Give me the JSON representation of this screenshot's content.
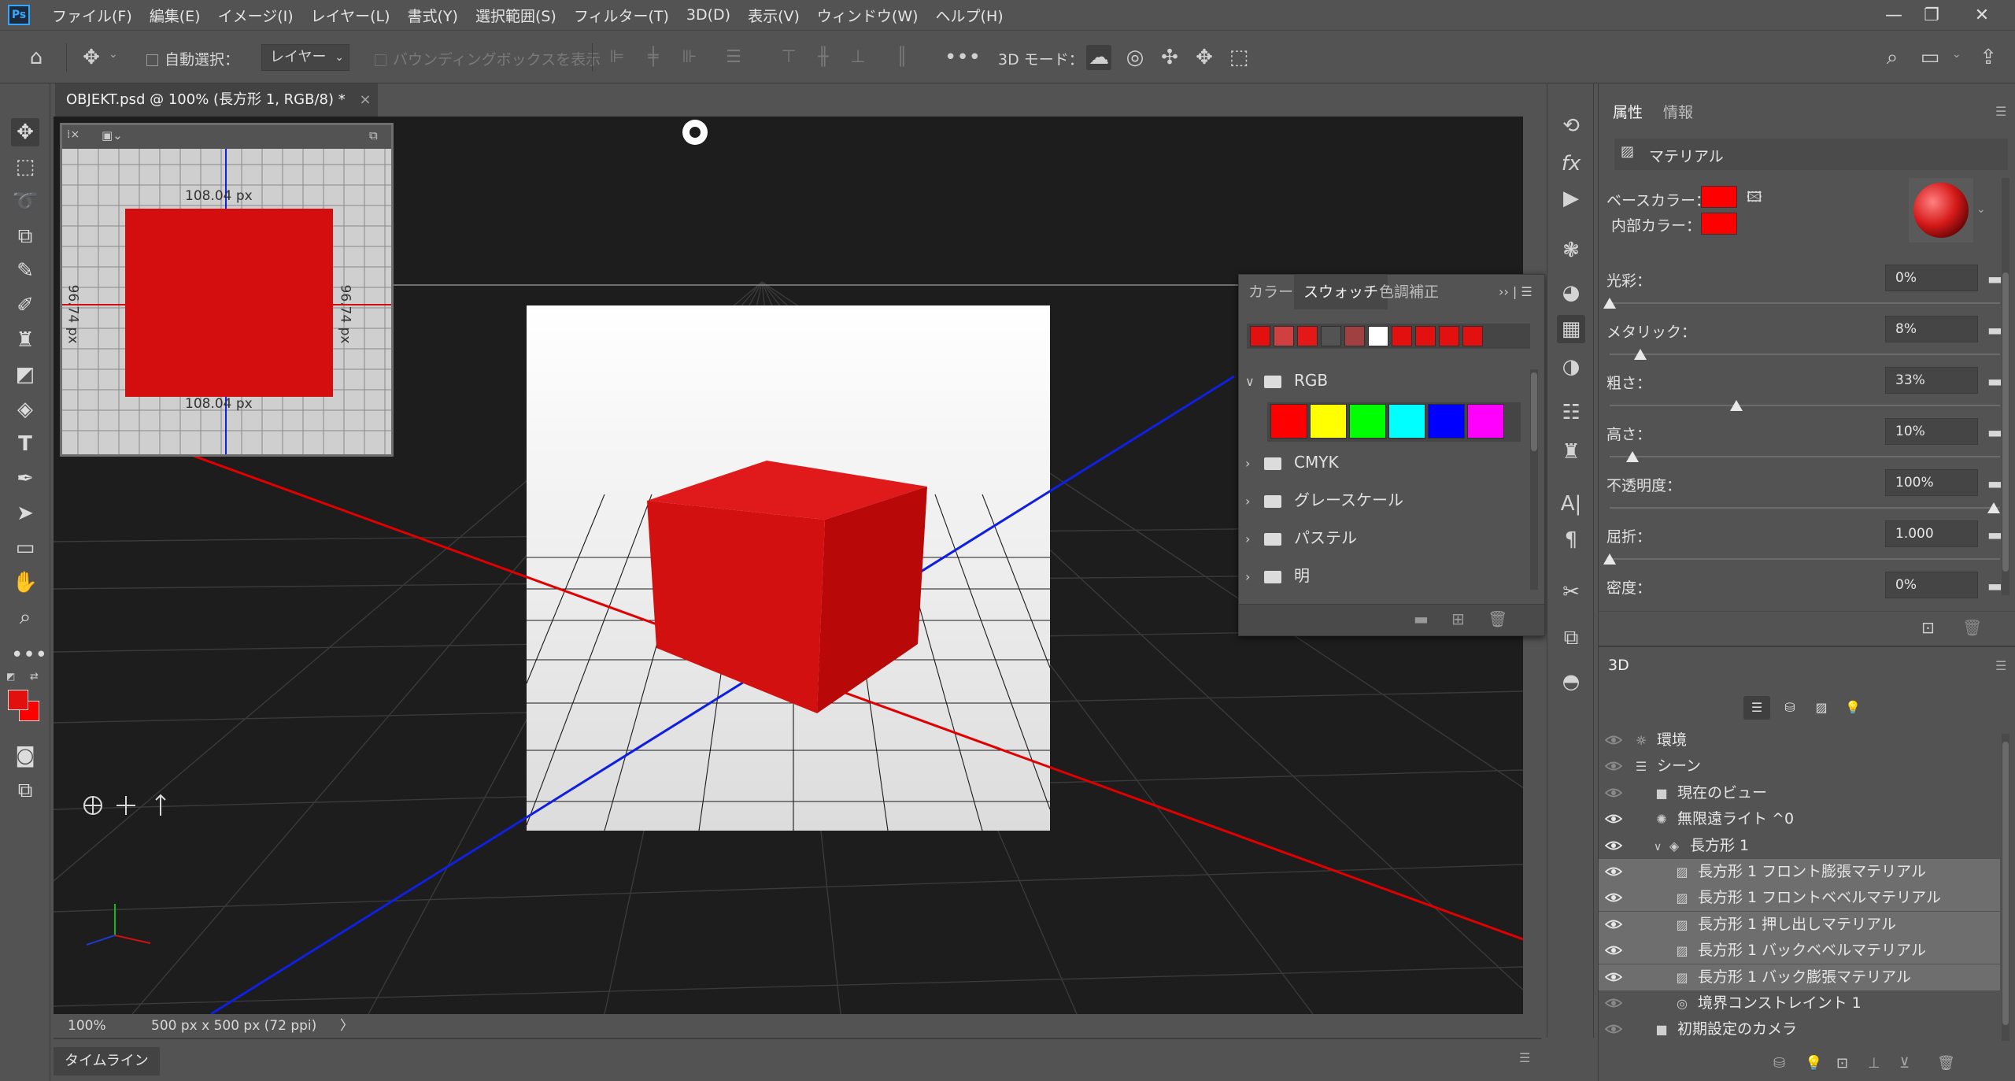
{
  "app": {
    "logo": "Ps"
  },
  "menu": [
    "ファイル(F)",
    "編集(E)",
    "イメージ(I)",
    "レイヤー(L)",
    "書式(Y)",
    "選択範囲(S)",
    "フィルター(T)",
    "3D(D)",
    "表示(V)",
    "ウィンドウ(W)",
    "ヘルプ(H)"
  ],
  "window_controls": {
    "minimize": "—",
    "restore": "❐",
    "close": "✕"
  },
  "options": {
    "auto_select_label": "自動選択：",
    "auto_select_target": "レイヤー",
    "bounding_box_label": "バウンディングボックスを表示",
    "three_d_mode_label": "3D モード："
  },
  "document": {
    "tab_title": "OBJEKT.psd @ 100% (長方形 1, RGB/8) *",
    "close_glyph": "×",
    "zoom": "100%",
    "doc_info": "500 px x 500 px (72 ppi)",
    "status_arrow": "〉"
  },
  "secondary_view": {
    "dim_top": "108.04  px",
    "dim_bottom": "108.04  px",
    "dim_left": "96.74  px",
    "dim_right": "96.74  px"
  },
  "swatches": {
    "tabs": [
      "カラー",
      "スウォッチ",
      "色調補正"
    ],
    "active_tab": 1,
    "recent_colors": [
      "#e31010",
      "#d04040",
      "#e51818",
      "#535353",
      "#a04040",
      "#ffffff",
      "#e31010",
      "#e31010",
      "#e31010",
      "#e31010"
    ],
    "groups": [
      {
        "name": "RGB",
        "expanded": true,
        "colors": [
          "#ff0000",
          "#ffff00",
          "#00ff00",
          "#00ffff",
          "#0000ff",
          "#ff00ff"
        ]
      },
      {
        "name": "CMYK",
        "expanded": false
      },
      {
        "name": "グレースケール",
        "expanded": false
      },
      {
        "name": "パステル",
        "expanded": false
      },
      {
        "name": "明",
        "expanded": false
      }
    ]
  },
  "properties": {
    "tabs": [
      "属性",
      "情報"
    ],
    "section": "マテリアル",
    "base_color_label": "ベースカラー：",
    "inner_color_label": "内部カラー：",
    "base_color": "#ff0000",
    "inner_color": "#ff0000",
    "params": [
      {
        "label": "光彩：",
        "value": "0%",
        "fraction": 0.0
      },
      {
        "label": "メタリック：",
        "value": "8%",
        "fraction": 0.08
      },
      {
        "label": "粗さ：",
        "value": "33%",
        "fraction": 0.33
      },
      {
        "label": "高さ：",
        "value": "10%",
        "fraction": 0.06
      },
      {
        "label": "不透明度：",
        "value": "100%",
        "fraction": 1.0
      },
      {
        "label": "屈折：",
        "value": "1.000",
        "fraction": 0.0
      },
      {
        "label": "密度：",
        "value": "0%",
        "fraction": null
      }
    ]
  },
  "panel3d": {
    "title": "3D",
    "items": [
      {
        "label": "環境",
        "indent": 0,
        "icon": "environment-icon",
        "glyph": "☼",
        "selected": false,
        "eye": "dim"
      },
      {
        "label": "シーン",
        "indent": 0,
        "icon": "scene-icon",
        "glyph": "☰",
        "selected": false,
        "eye": "dim"
      },
      {
        "label": "現在のビュー",
        "indent": 1,
        "icon": "camera-icon",
        "glyph": "■",
        "selected": false,
        "eye": "dim"
      },
      {
        "label": "無限遠ライト ^0",
        "indent": 1,
        "icon": "light-icon",
        "glyph": "✺",
        "selected": false,
        "eye": "on"
      },
      {
        "label": "長方形 1",
        "indent": 1,
        "icon": "mesh-icon",
        "glyph": "◈",
        "selected": false,
        "eye": "on",
        "chevron": "∨"
      },
      {
        "label": "長方形 1 フロント膨張マテリアル",
        "indent": 2,
        "icon": "material-icon",
        "glyph": "▨",
        "selected": true,
        "eye": "on"
      },
      {
        "label": "長方形 1 フロントベベルマテリアル",
        "indent": 2,
        "icon": "material-icon",
        "glyph": "▨",
        "selected": true,
        "eye": "on"
      },
      {
        "label": "長方形 1 押し出しマテリアル",
        "indent": 2,
        "icon": "material-icon",
        "glyph": "▨",
        "selected": true,
        "eye": "on"
      },
      {
        "label": "長方形 1 バックベベルマテリアル",
        "indent": 2,
        "icon": "material-icon",
        "glyph": "▨",
        "selected": true,
        "eye": "on"
      },
      {
        "label": "長方形 1 バック膨張マテリアル",
        "indent": 2,
        "icon": "material-icon",
        "glyph": "▨",
        "selected": true,
        "eye": "on"
      },
      {
        "label": "境界コンストレイント 1",
        "indent": 2,
        "icon": "constraint-icon",
        "glyph": "◎",
        "selected": false,
        "eye": "dim"
      },
      {
        "label": "初期設定のカメラ",
        "indent": 1,
        "icon": "camera-icon",
        "glyph": "■",
        "selected": false,
        "eye": "dim"
      }
    ]
  },
  "timeline": {
    "label": "タイムライン"
  },
  "colors": {
    "foreground": "#e31010",
    "background": "#ff0000",
    "cube": "#d61010",
    "accent": "#31a8ff"
  }
}
